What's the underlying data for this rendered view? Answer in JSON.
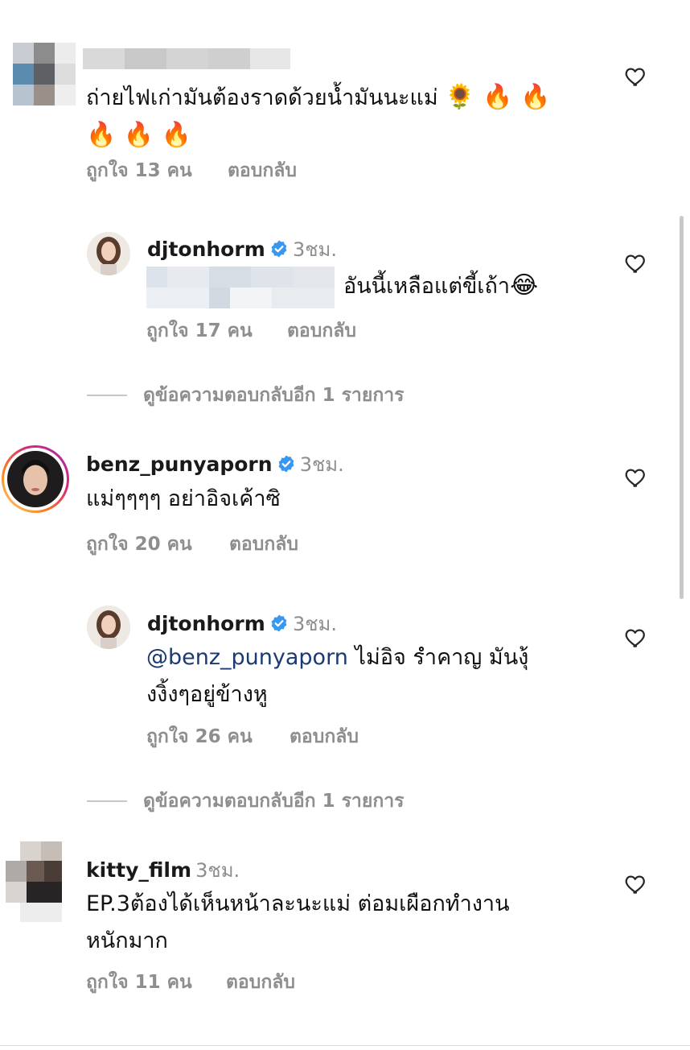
{
  "comments": [
    {
      "username_hidden": true,
      "text": "ถ่ายไฟเก่ามันต้องราดด้วยน้ำมันนะแม่",
      "emoji_line1": "🌻 🔥 🔥",
      "emoji_line2": "🔥 🔥 🔥",
      "likes": "ถูกใจ 13 คน",
      "reply": "ตอบกลับ"
    },
    {
      "username": "djtonhorm",
      "time": "3ชม.",
      "text": "อันนี้เหลือแต่ขี้เถ้า",
      "emoji": "😂",
      "likes": "ถูกใจ 17 คน",
      "reply": "ตอบกลับ"
    },
    {
      "view_more": "ดูข้อความตอบกลับอีก 1 รายการ"
    },
    {
      "username": "benz_punyaporn",
      "time": "3ชม.",
      "text": "แม่ๆๆๆๆ อย่าอิจเค้าซิ",
      "likes": "ถูกใจ 20 คน",
      "reply": "ตอบกลับ"
    },
    {
      "username": "djtonhorm",
      "time": "3ชม.",
      "mention": "@benz_punyaporn",
      "text_line1": "ไม่อิจ รำคาญ มันงุ้",
      "text_line2": "งงิ้งๆอยู่ข้างหู",
      "likes": "ถูกใจ 26 คน",
      "reply": "ตอบกลับ"
    },
    {
      "view_more": "ดูข้อความตอบกลับอีก 1 รายการ"
    },
    {
      "username": "kitty_film",
      "time": "3ชม.",
      "text_line1": "EP.3ต้องได้เห็นหน้าละนะแม่ ต่อมเผือกทำงาน",
      "text_line2": "หนักมาก",
      "likes": "ถูกใจ 11 คน",
      "reply": "ตอบกลับ"
    }
  ],
  "icons": {
    "like": "heart-outline-icon",
    "verified": "verified-badge-icon"
  },
  "colors": {
    "verified_blue": "#3897f0",
    "mention": "#1b3a73",
    "muted": "#8e8e8e",
    "story_ring_start": "#feda75",
    "story_ring_end": "#d62976"
  }
}
